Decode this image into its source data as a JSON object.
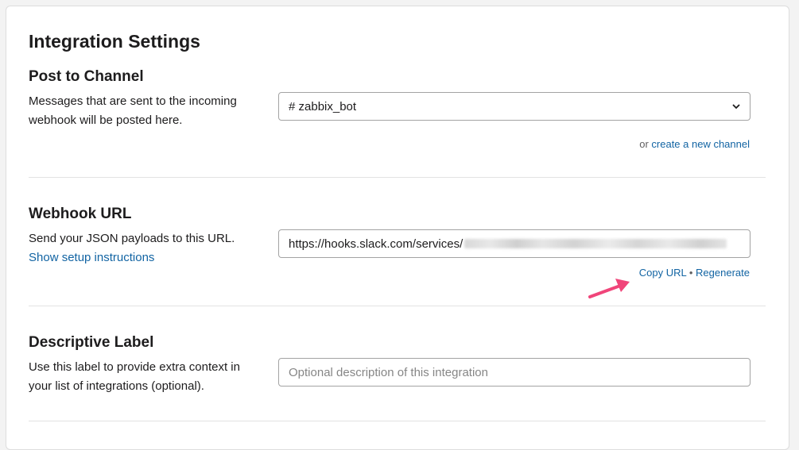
{
  "page": {
    "title": "Integration Settings"
  },
  "post_to_channel": {
    "heading": "Post to Channel",
    "description": "Messages that are sent to the incoming webhook will be posted here.",
    "selected_channel": "# zabbix_bot",
    "chevron_icon": "chevron-down-icon",
    "or_text": "or",
    "create_link": "create a new channel"
  },
  "webhook_url": {
    "heading": "Webhook URL",
    "description": "Send your JSON payloads to this URL.",
    "setup_link": "Show setup instructions",
    "url_value": "https://hooks.slack.com/services/",
    "copy_link": "Copy URL",
    "separator": "•",
    "regenerate_link": "Regenerate"
  },
  "descriptive_label": {
    "heading": "Descriptive Label",
    "description": "Use this label to provide extra context in your list of integrations (optional).",
    "placeholder": "Optional description of this integration"
  },
  "annotation": {
    "arrow_icon": "pink-arrow-icon",
    "color": "#f0457a"
  },
  "colors": {
    "link": "#1264a3",
    "text": "#1d1c1d",
    "muted": "#616061"
  }
}
